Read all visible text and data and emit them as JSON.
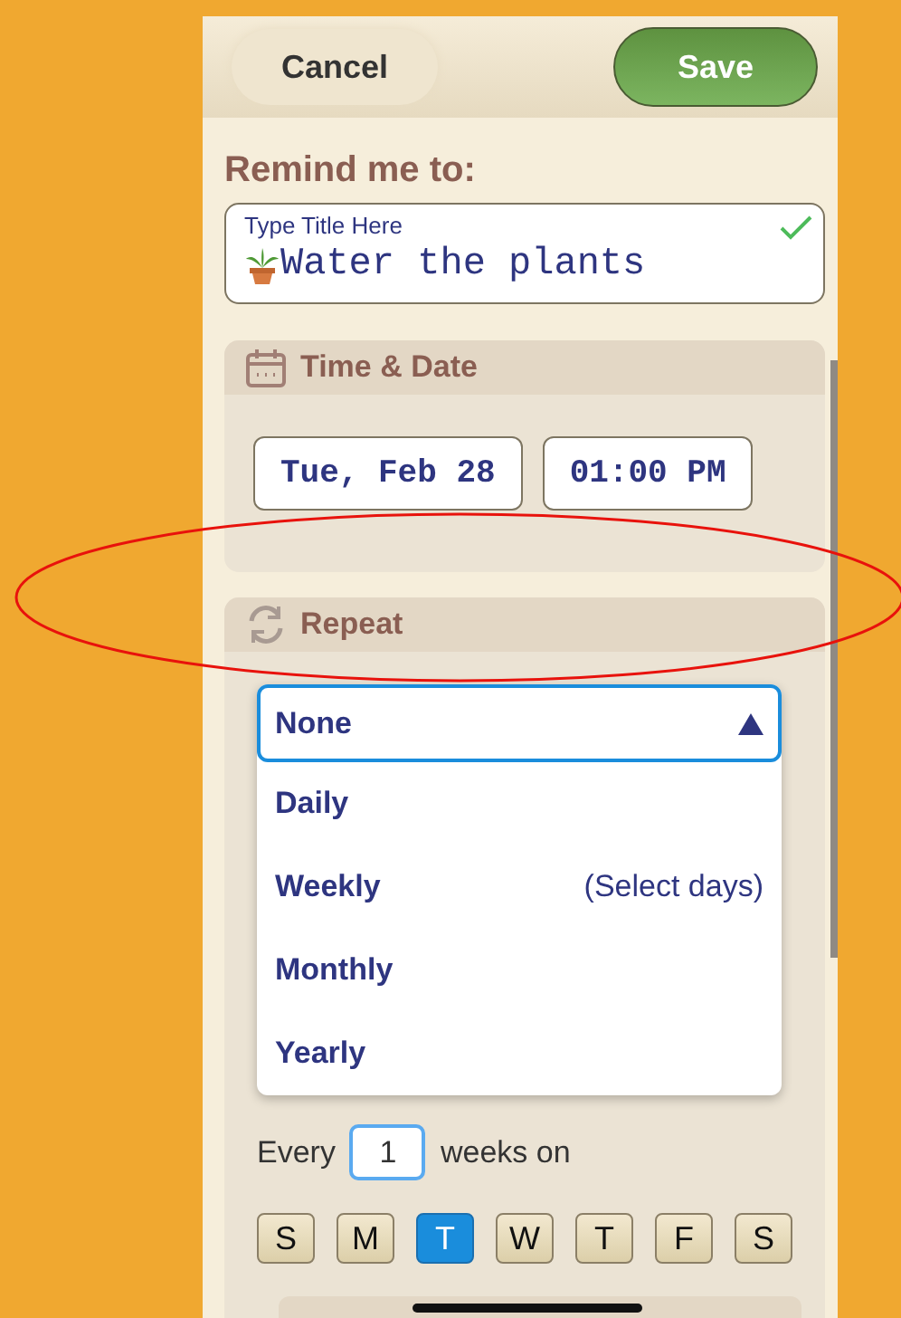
{
  "header": {
    "cancel": "Cancel",
    "save": "Save"
  },
  "title_label": "Remind me to:",
  "title_field": {
    "placeholder": "Type Title Here",
    "value": "Water the plants",
    "valid": true
  },
  "time_date": {
    "heading": "Time & Date",
    "date": "Tue, Feb 28",
    "time": "01:00 PM"
  },
  "repeat": {
    "heading": "Repeat",
    "expanded": true,
    "options": [
      {
        "label": "None",
        "selected": true
      },
      {
        "label": "Daily",
        "selected": false
      },
      {
        "label": "Weekly",
        "hint": "(Select days)",
        "selected": false
      },
      {
        "label": "Monthly",
        "selected": false
      },
      {
        "label": "Yearly",
        "selected": false
      }
    ],
    "every_label": "Every",
    "interval": "1",
    "unit_label": "weeks on",
    "days": [
      {
        "label": "S",
        "selected": false
      },
      {
        "label": "M",
        "selected": false
      },
      {
        "label": "T",
        "selected": true
      },
      {
        "label": "W",
        "selected": false
      },
      {
        "label": "T",
        "selected": false
      },
      {
        "label": "F",
        "selected": false
      },
      {
        "label": "S",
        "selected": false
      }
    ]
  }
}
